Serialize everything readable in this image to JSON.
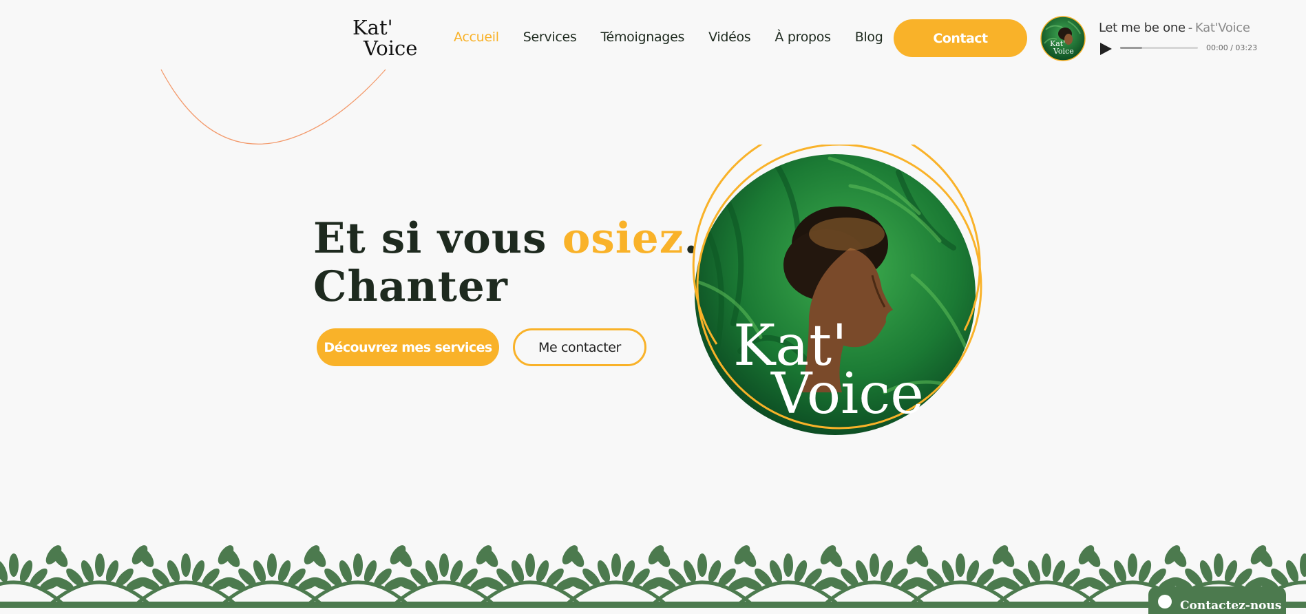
{
  "header": {
    "logo_line1": "Kat'",
    "logo_line2": "Voice",
    "nav": [
      {
        "label": "Accueil",
        "active": true
      },
      {
        "label": "Services",
        "active": false
      },
      {
        "label": "Témoignages",
        "active": false
      },
      {
        "label": "Vidéos",
        "active": false
      },
      {
        "label": "À propos",
        "active": false
      },
      {
        "label": "Blog",
        "active": false
      }
    ],
    "contact_label": "Contact"
  },
  "player": {
    "track_title": "Let me be one",
    "separator": "-",
    "artist": "Kat'Voice",
    "time": "00:00 / 03:23",
    "progress_loaded_pct": 28,
    "thumb_text_line1": "Kat'",
    "thumb_text_line2": "Voice"
  },
  "hero": {
    "title_part1": "Et si vous ",
    "title_accent": "osiez",
    "title_part2": "...",
    "title_line2": "Chanter",
    "primary_button": "Découvrez mes services",
    "secondary_button": "Me contacter",
    "image_text_line1": "Kat'",
    "image_text_line2": "Voice"
  },
  "chat": {
    "label": "Contactez-nous"
  },
  "colors": {
    "accent": "#f9b229",
    "dark_green": "#1e2a1f",
    "foliage": "#4c7a4e",
    "background": "#f8f8f8"
  }
}
